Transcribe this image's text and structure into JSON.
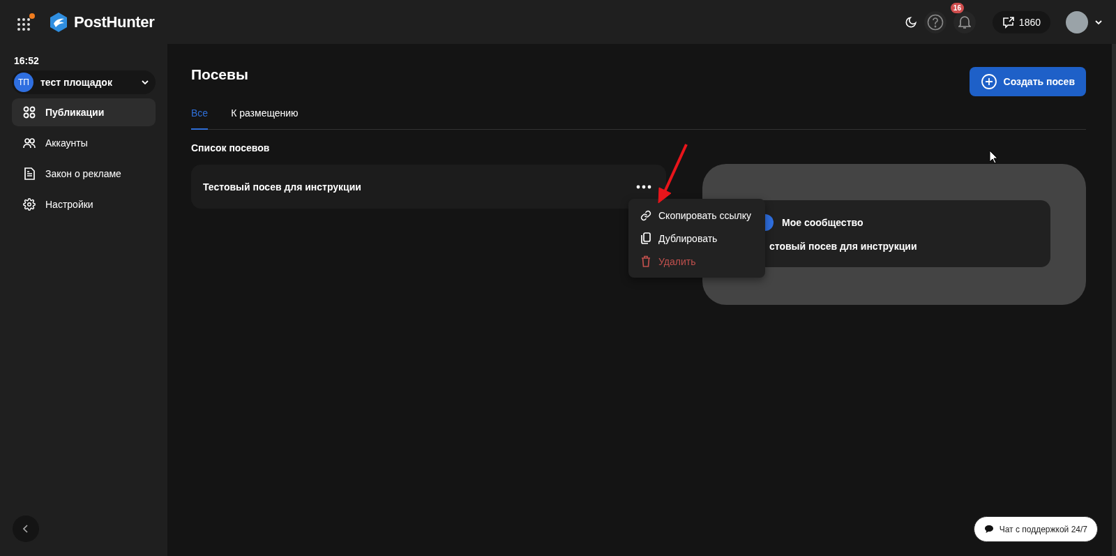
{
  "topbar": {
    "logo_text": "PostHunter",
    "notification_count": "16",
    "balance": "1860"
  },
  "sidebar": {
    "time": "16:52",
    "workspace": {
      "initials": "ТП",
      "name": "тест площадок"
    },
    "items": [
      {
        "label": "Публикации",
        "kind": "grid",
        "selected": true
      },
      {
        "label": "Аккаунты",
        "kind": "people",
        "selected": false
      },
      {
        "label": "Закон о рекламе",
        "kind": "document",
        "selected": false
      },
      {
        "label": "Настройки",
        "kind": "gear",
        "selected": false
      }
    ]
  },
  "page": {
    "title": "Посевы",
    "create_button": "Создать посев",
    "tabs": [
      {
        "label": "Все",
        "selected": true
      },
      {
        "label": "К размещению",
        "selected": false
      }
    ],
    "list_title": "Список посевов",
    "posts": [
      {
        "title": "Тестовый посев для инструкции"
      }
    ]
  },
  "context_menu": {
    "items": [
      {
        "label": "Скопировать ссылку",
        "kind": "link"
      },
      {
        "label": "Дублировать",
        "kind": "copy"
      },
      {
        "label": "Удалить",
        "kind": "delete"
      }
    ]
  },
  "preview": {
    "community": "Мое сообщество",
    "text": "стовый посев для инструкции"
  },
  "chat_button": "Чат с поддержкой 24/7"
}
